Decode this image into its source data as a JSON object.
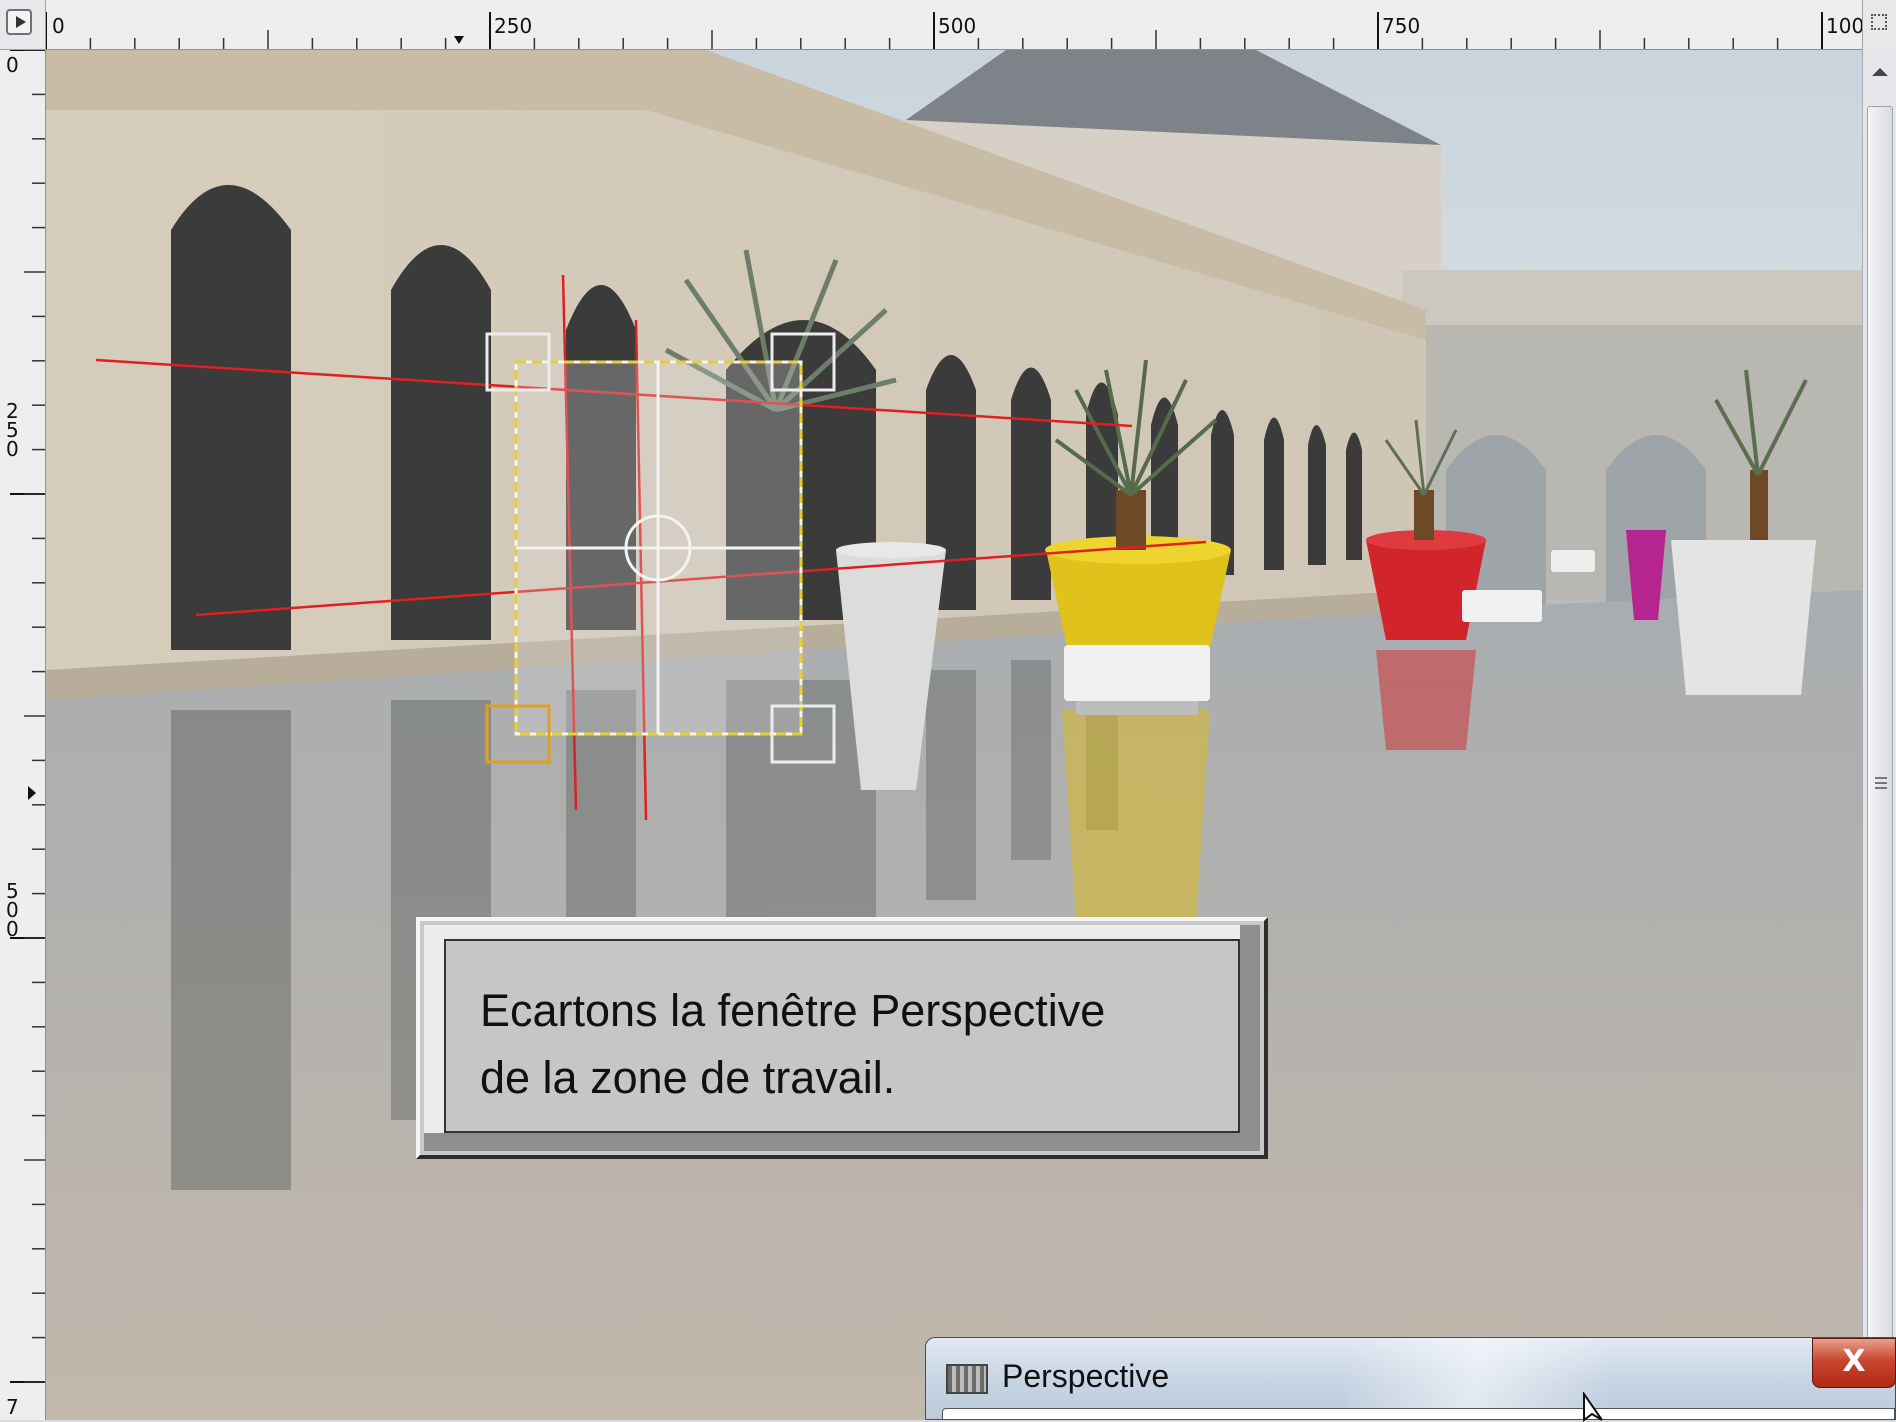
{
  "rulers": {
    "horizontal_labels": [
      "0",
      "250",
      "500",
      "750",
      "100"
    ],
    "vertical_labels": [
      "0",
      "250",
      "500",
      "7"
    ]
  },
  "canvas": {
    "image_description_icon": "photo-icon"
  },
  "tooltip": {
    "line1": "Ecartons la fenêtre Perspective",
    "line2": "de la zone de travail."
  },
  "perspective_dialog": {
    "title": "Perspective",
    "close_label": "X"
  },
  "colors": {
    "guide_line": "#e02020",
    "selection": "#e8d030",
    "handle_active": "#e0a020"
  }
}
